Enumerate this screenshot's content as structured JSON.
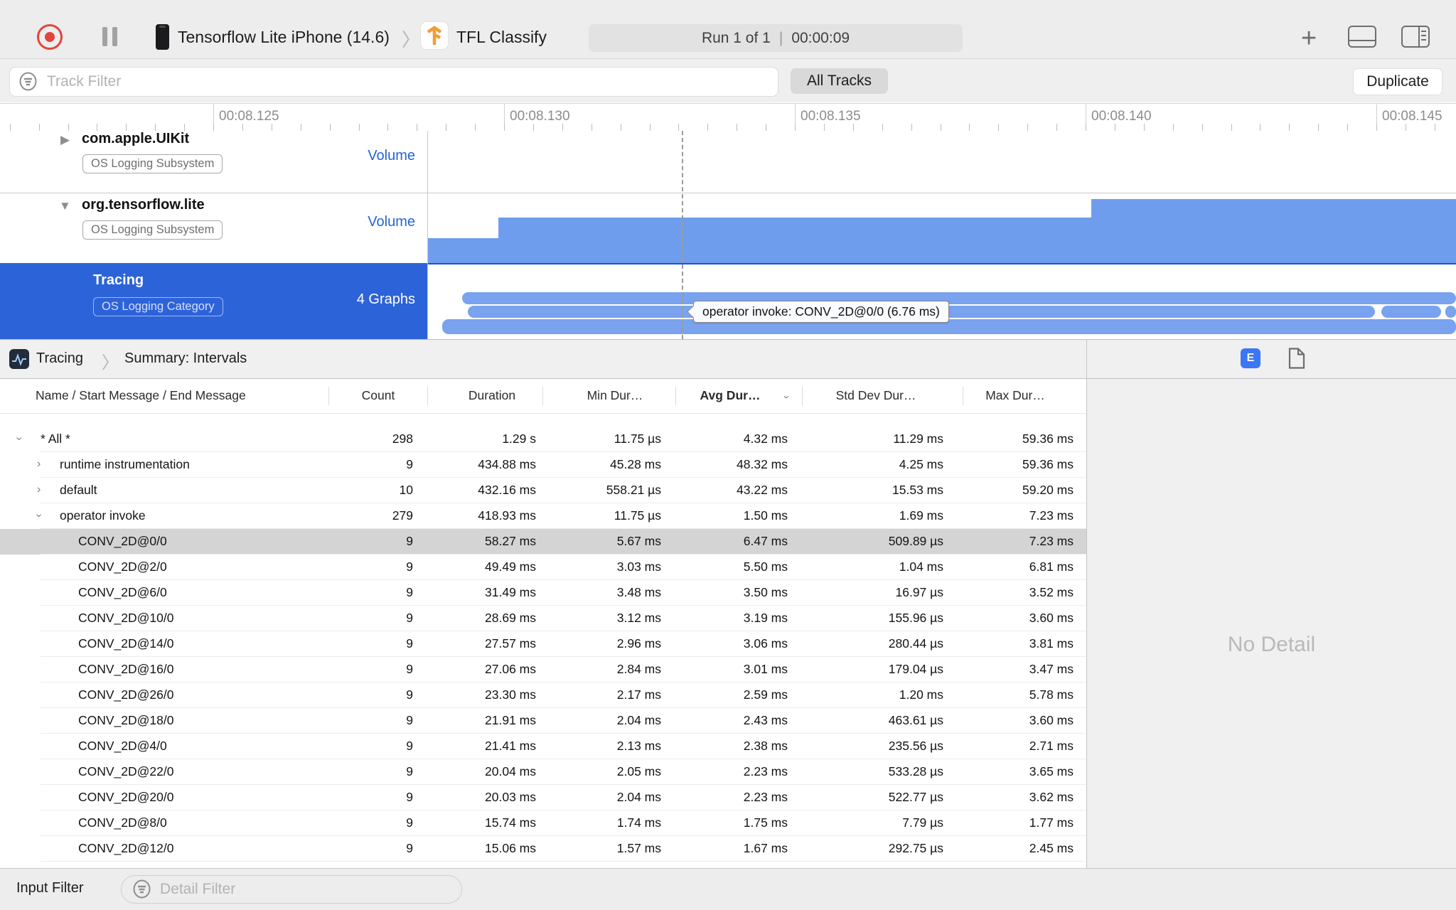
{
  "toolbar": {
    "device": "Tensorflow Lite iPhone (14.6)",
    "chevron": "〉",
    "target": "TFL Classify",
    "run_label": "Run 1 of 1",
    "run_separator": "|",
    "run_time": "00:00:09",
    "plus_label": "+"
  },
  "filter_bar": {
    "track_filter_placeholder": "Track Filter",
    "all_tracks_label": "All Tracks",
    "duplicate_label": "Duplicate"
  },
  "ruler": {
    "labels": [
      "00:08.125",
      "00:08.130",
      "00:08.135",
      "00:08.140",
      "00:08.145"
    ]
  },
  "tracks": [
    {
      "name": "com.apple.UIKit",
      "badge": "OS Logging Subsystem",
      "meta": "Volume",
      "disclosure": "collapsed"
    },
    {
      "name": "org.tensorflow.lite",
      "badge": "OS Logging Subsystem",
      "meta": "Volume",
      "disclosure": "expanded"
    },
    {
      "name": "Tracing",
      "badge": "OS Logging Category",
      "meta": "4 Graphs",
      "disclosure": "none",
      "selected": true
    }
  ],
  "tooltip_text": "operator invoke: CONV_2D@0/0 (6.76 ms)",
  "detail": {
    "breadcrumb": {
      "root": "Tracing",
      "page": "Summary: Intervals"
    },
    "columns": {
      "name": "Name / Start Message / End Message",
      "count": "Count",
      "duration": "Duration",
      "min": "Min Dur…",
      "avg": "Avg Dur…",
      "std": "Std Dev Dur…",
      "max": "Max Dur…"
    },
    "sorted_column": "avg",
    "rows": [
      {
        "indent": 0,
        "chev": "down",
        "name": "* All *",
        "count": "298",
        "duration": "1.29 s",
        "min": "11.75 µs",
        "avg": "4.32 ms",
        "std": "11.29 ms",
        "max": "59.36 ms"
      },
      {
        "indent": 1,
        "chev": "right",
        "name": "runtime instrumentation",
        "count": "9",
        "duration": "434.88 ms",
        "min": "45.28 ms",
        "avg": "48.32 ms",
        "std": "4.25 ms",
        "max": "59.36 ms"
      },
      {
        "indent": 1,
        "chev": "right",
        "name": "default",
        "count": "10",
        "duration": "432.16 ms",
        "min": "558.21 µs",
        "avg": "43.22 ms",
        "std": "15.53 ms",
        "max": "59.20 ms"
      },
      {
        "indent": 1,
        "chev": "down",
        "name": "operator invoke",
        "count": "279",
        "duration": "418.93 ms",
        "min": "11.75 µs",
        "avg": "1.50 ms",
        "std": "1.69 ms",
        "max": "7.23 ms"
      },
      {
        "indent": 2,
        "chev": "none",
        "name": "CONV_2D@0/0",
        "selected": true,
        "count": "9",
        "duration": "58.27 ms",
        "min": "5.67 ms",
        "avg": "6.47 ms",
        "std": "509.89 µs",
        "max": "7.23 ms"
      },
      {
        "indent": 2,
        "chev": "none",
        "name": "CONV_2D@2/0",
        "count": "9",
        "duration": "49.49 ms",
        "min": "3.03 ms",
        "avg": "5.50 ms",
        "std": "1.04 ms",
        "max": "6.81 ms"
      },
      {
        "indent": 2,
        "chev": "none",
        "name": "CONV_2D@6/0",
        "count": "9",
        "duration": "31.49 ms",
        "min": "3.48 ms",
        "avg": "3.50 ms",
        "std": "16.97 µs",
        "max": "3.52 ms"
      },
      {
        "indent": 2,
        "chev": "none",
        "name": "CONV_2D@10/0",
        "count": "9",
        "duration": "28.69 ms",
        "min": "3.12 ms",
        "avg": "3.19 ms",
        "std": "155.96 µs",
        "max": "3.60 ms"
      },
      {
        "indent": 2,
        "chev": "none",
        "name": "CONV_2D@14/0",
        "count": "9",
        "duration": "27.57 ms",
        "min": "2.96 ms",
        "avg": "3.06 ms",
        "std": "280.44 µs",
        "max": "3.81 ms"
      },
      {
        "indent": 2,
        "chev": "none",
        "name": "CONV_2D@16/0",
        "count": "9",
        "duration": "27.06 ms",
        "min": "2.84 ms",
        "avg": "3.01 ms",
        "std": "179.04 µs",
        "max": "3.47 ms"
      },
      {
        "indent": 2,
        "chev": "none",
        "name": "CONV_2D@26/0",
        "count": "9",
        "duration": "23.30 ms",
        "min": "2.17 ms",
        "avg": "2.59 ms",
        "std": "1.20 ms",
        "max": "5.78 ms"
      },
      {
        "indent": 2,
        "chev": "none",
        "name": "CONV_2D@18/0",
        "count": "9",
        "duration": "21.91 ms",
        "min": "2.04 ms",
        "avg": "2.43 ms",
        "std": "463.61 µs",
        "max": "3.60 ms"
      },
      {
        "indent": 2,
        "chev": "none",
        "name": "CONV_2D@4/0",
        "count": "9",
        "duration": "21.41 ms",
        "min": "2.13 ms",
        "avg": "2.38 ms",
        "std": "235.56 µs",
        "max": "2.71 ms"
      },
      {
        "indent": 2,
        "chev": "none",
        "name": "CONV_2D@22/0",
        "count": "9",
        "duration": "20.04 ms",
        "min": "2.05 ms",
        "avg": "2.23 ms",
        "std": "533.28 µs",
        "max": "3.65 ms"
      },
      {
        "indent": 2,
        "chev": "none",
        "name": "CONV_2D@20/0",
        "count": "9",
        "duration": "20.03 ms",
        "min": "2.04 ms",
        "avg": "2.23 ms",
        "std": "522.77 µs",
        "max": "3.62 ms"
      },
      {
        "indent": 2,
        "chev": "none",
        "name": "CONV_2D@8/0",
        "count": "9",
        "duration": "15.74 ms",
        "min": "1.74 ms",
        "avg": "1.75 ms",
        "std": "7.79 µs",
        "max": "1.77 ms"
      },
      {
        "indent": 2,
        "chev": "none",
        "name": "CONV_2D@12/0",
        "count": "9",
        "duration": "15.06 ms",
        "min": "1.57 ms",
        "avg": "1.67 ms",
        "std": "292.75 µs",
        "max": "2.45 ms"
      }
    ]
  },
  "right_panel": {
    "extended_detail_tab": "E",
    "no_detail_text": "No Detail"
  },
  "bottom_bar": {
    "label": "Input Filter",
    "placeholder": "Detail Filter"
  },
  "colors": {
    "selection_blue": "#2d63d9",
    "graph_bar_blue": "#79a3ee",
    "volume_fill_blue": "#6f9ded",
    "record_red": "#e2453c",
    "meta_link_blue": "#2166d6",
    "extended_detail_tab_blue": "#3b76f6",
    "selected_row_gray": "#d4d4d4"
  }
}
